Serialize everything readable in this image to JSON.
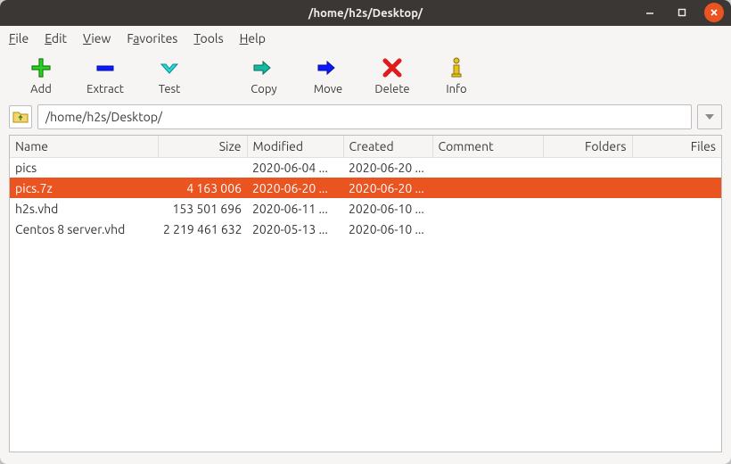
{
  "window": {
    "title": "/home/h2s/Desktop/"
  },
  "menubar": {
    "file": "File",
    "edit": "Edit",
    "view": "View",
    "favorites": "Favorites",
    "tools": "Tools",
    "help": "Help"
  },
  "toolbar": {
    "add": "Add",
    "extract": "Extract",
    "test": "Test",
    "copy": "Copy",
    "move": "Move",
    "delete": "Delete",
    "info": "Info"
  },
  "path": "/home/h2s/Desktop/",
  "columns": {
    "name": "Name",
    "size": "Size",
    "modified": "Modified",
    "created": "Created",
    "comment": "Comment",
    "folders": "Folders",
    "files": "Files"
  },
  "rows": [
    {
      "name": "pics",
      "size": "",
      "modified": "2020-06-04 ...",
      "created": "2020-06-20 ...",
      "selected": false
    },
    {
      "name": "pics.7z",
      "size": "4 163 006",
      "modified": "2020-06-20 ...",
      "created": "2020-06-20 ...",
      "selected": true
    },
    {
      "name": "h2s.vhd",
      "size": "153 501 696",
      "modified": "2020-06-11 ...",
      "created": "2020-06-10 ...",
      "selected": false
    },
    {
      "name": "Centos 8 server.vhd",
      "size": "2 219 461 632",
      "modified": "2020-05-13 ...",
      "created": "2020-06-10 ...",
      "selected": false
    }
  ]
}
